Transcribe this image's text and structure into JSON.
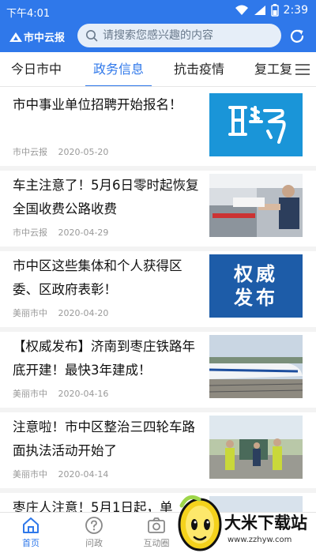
{
  "status_bar": {
    "time": "下午4:01",
    "battery": "2:39"
  },
  "header": {
    "logo": "市中云报",
    "search_placeholder": "请搜索您感兴趣的内容"
  },
  "tabs": [
    {
      "label": "今日市中",
      "active": false
    },
    {
      "label": "政务信息",
      "active": true
    },
    {
      "label": "抗击疫情",
      "active": false
    },
    {
      "label": "复工复",
      "active": false
    }
  ],
  "news": [
    {
      "title": "市中事业单位招聘开始报名！",
      "source": "市中云报",
      "date": "2020-05-20",
      "thumb": "招聘 logo (聘)"
    },
    {
      "title": "车主注意了！5月6日零时起恢复全国收费公路收费",
      "source": "市中云报",
      "date": "2020-04-29",
      "thumb": "toll booth photo"
    },
    {
      "title": "市中区这些集体和个人获得区委、区政府表彰！",
      "source": "美丽市中",
      "date": "2020-04-20",
      "thumb_text": "权威发布"
    },
    {
      "title": "【权威发布】济南到枣庄铁路年底开建！最快3年建成！",
      "source": "美丽市中",
      "date": "2020-04-16",
      "thumb": "high-speed train photo"
    },
    {
      "title": "注意啦！市中区整治三四轮车路面执法活动开始了",
      "source": "美丽市中",
      "date": "2020-04-14",
      "thumb": "traffic police photo"
    },
    {
      "title": "枣庄人注意！5月1日起，单",
      "source": "",
      "date": "",
      "thumb": "partial"
    }
  ],
  "bottom_nav": [
    {
      "label": "首页",
      "active": true,
      "icon": "home-icon"
    },
    {
      "label": "问政",
      "active": false,
      "icon": "question-icon"
    },
    {
      "label": "互动圈",
      "active": false,
      "icon": "camera-icon"
    }
  ],
  "watermark": {
    "text": "大米下载站",
    "url": "www.zzhyw.com"
  },
  "colors": {
    "primary": "#2f78ea",
    "meta": "#999999"
  }
}
